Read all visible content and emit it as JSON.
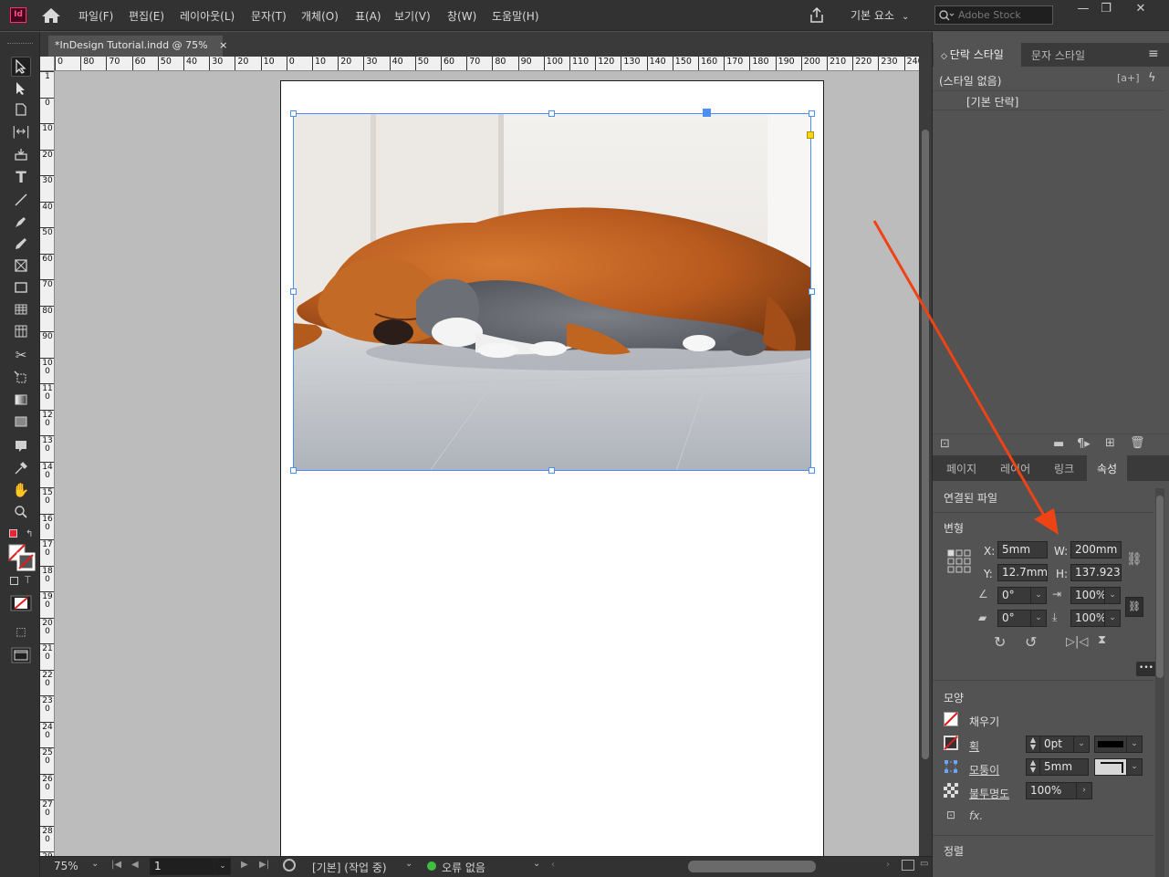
{
  "menubar": {
    "app_icon": "Id",
    "menus": [
      "파일(F)",
      "편집(E)",
      "레이아웃(L)",
      "문자(T)",
      "개체(O)",
      "표(A)",
      "보기(V)",
      "창(W)",
      "도움말(H)"
    ],
    "workspace": "기본 요소",
    "search_placeholder": "Adobe Stock"
  },
  "document_tab": {
    "title": "*InDesign Tutorial.indd @ 75%",
    "close": "×"
  },
  "ruler": {
    "h_labels": [
      "0",
      "80",
      "70",
      "60",
      "50",
      "40",
      "30",
      "20",
      "10",
      "0",
      "10",
      "20",
      "30",
      "40",
      "50",
      "60",
      "70",
      "80",
      "90",
      "100",
      "110",
      "120",
      "130",
      "140",
      "150",
      "160",
      "170",
      "180",
      "190",
      "200",
      "210",
      "220",
      "230",
      "240"
    ],
    "v_labels": [
      "1",
      "0",
      "1 0",
      "2 0",
      "3 0",
      "4 0",
      "5 0",
      "6 0",
      "7 0",
      "8 0",
      "9 0",
      "1 0 0",
      "1 1 0",
      "1 2 0",
      "1 3 0",
      "1 4 0",
      "1 5 0",
      "1 6 0",
      "1 7 0",
      "1 8 0",
      "1 9 0",
      "2 0 0",
      "2 1 0",
      "2 2 0",
      "2 3 0",
      "2 4 0",
      "2 5 0",
      "2 6 0",
      "2 7 0",
      "2 8 0",
      "2 9 0"
    ]
  },
  "status": {
    "zoom": "75%",
    "page": "1",
    "preflight_profile": "[기본] (작업 중)",
    "errors": "오류 없음"
  },
  "paragraph_panel": {
    "tabs": [
      "단락 스타일",
      "문자 스타일"
    ],
    "header_item": "(스타일 없음)",
    "header_badge": "[a+]",
    "items": [
      "[기본 단락]"
    ]
  },
  "properties_panel": {
    "tabs": [
      "페이지",
      "레이어",
      "링크",
      "속성"
    ],
    "section_linked": "연결된 파일",
    "section_transform": "변형",
    "x_label": "X:",
    "x_value": "5mm",
    "y_label": "Y:",
    "y_value": "12.7mm",
    "w_label": "W:",
    "w_value": "200mm",
    "h_label": "H:",
    "h_value": "137.923r",
    "rotate_value": "0°",
    "shear_value": "0°",
    "scale_x_value": "100%",
    "scale_y_value": "100%",
    "section_appearance": "모양",
    "fill_label": "채우기",
    "stroke_label": "획",
    "stroke_weight": "0pt",
    "corner_label": "모퉁이",
    "corner_value": "5mm",
    "opacity_label": "불투명도",
    "opacity_value": "100%",
    "fx_label": "fx.",
    "section_align": "정렬",
    "more": "•••"
  },
  "colors": {
    "accent_arrow": "#ef4315",
    "selection": "#4d8ef2",
    "status_ok": "#3fbf3f"
  }
}
